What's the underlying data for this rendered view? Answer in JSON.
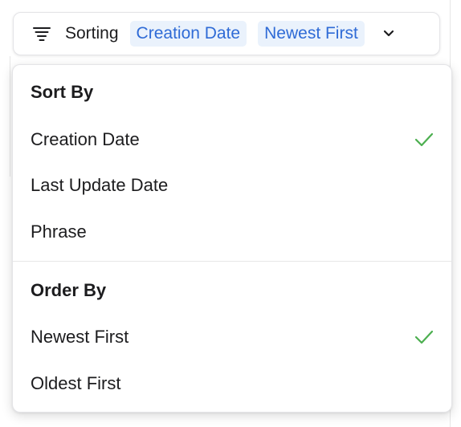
{
  "sort_bar": {
    "label": "Sorting",
    "sort_field_chip": "Creation Date",
    "order_chip": "Newest First",
    "icon": "filter-lines-icon",
    "expand_icon": "chevron-down-icon"
  },
  "menu": {
    "sort_by": {
      "title": "Sort By",
      "items": [
        {
          "label": "Creation Date",
          "selected": true
        },
        {
          "label": "Last Update Date",
          "selected": false
        },
        {
          "label": "Phrase",
          "selected": false
        }
      ]
    },
    "order_by": {
      "title": "Order By",
      "items": [
        {
          "label": "Newest First",
          "selected": true
        },
        {
          "label": "Oldest First",
          "selected": false
        }
      ]
    }
  },
  "colors": {
    "chip_background": "#eaf2fc",
    "chip_text": "#2f6bd6",
    "check": "#4caf50",
    "text": "#1c1c1e"
  }
}
